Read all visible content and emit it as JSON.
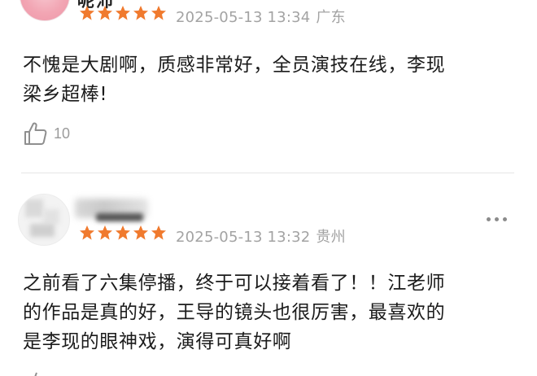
{
  "comments": [
    {
      "username": "呢沛",
      "rating": 5,
      "date": "2025-05-13 13:34",
      "region": "广东",
      "text_lines": [
        "不愧是大剧啊，质感非常好，全员演技在线，李现",
        "梁乡超棒!"
      ],
      "likes": "10"
    },
    {
      "username": "",
      "rating": 5,
      "date": "2025-05-13 13:32",
      "region": "贵州",
      "text_lines": [
        "之前看了六集停播，终于可以接着看了！！江老师",
        "的作品是真的好，王导的镜头也很厉害，最喜欢的",
        "是李现的眼神戏，演得可真好啊"
      ]
    }
  ],
  "colors": {
    "star": "#f07a2e",
    "meta_text": "#a3a3a3",
    "comment_text": "#1b1b1b",
    "divider": "#e6e6e6"
  },
  "icons": {
    "like": "thumbs-up-icon",
    "more": "more-dots-icon",
    "star": "star-icon"
  }
}
